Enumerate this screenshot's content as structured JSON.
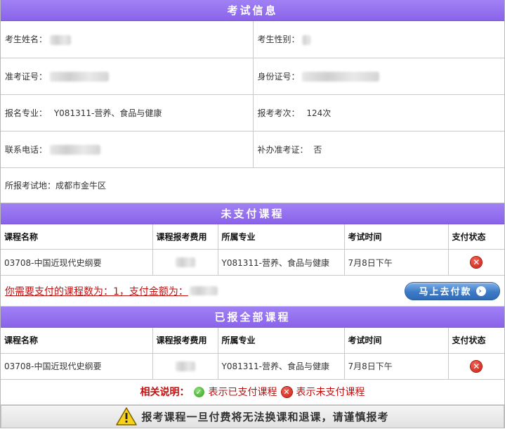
{
  "exam_info": {
    "title": "考试信息",
    "name_label": "考生姓名：",
    "gender_label": "考生性别：",
    "ticket_label": "准考证号：",
    "id_label": "身份证号：",
    "major_label": "报名专业：",
    "major_value": "Y081311-营养、食品与健康",
    "session_label": "报考考次：",
    "session_value": "124次",
    "phone_label": "联系电话：",
    "reissue_label": "补办准考证：",
    "reissue_value": "否",
    "location_label": "所报考试地：",
    "location_value": "成都市金牛区"
  },
  "unpaid": {
    "title": "未支付课程",
    "columns": [
      "课程名称",
      "课程报考费用",
      "所属专业",
      "考试时间",
      "支付状态"
    ],
    "rows": [
      {
        "course": "03708-中国近现代史纲要",
        "major": "Y081311-营养、食品与健康",
        "time": "7月8日下午",
        "status_icon": "x-icon"
      }
    ],
    "pay_summary": "你需要支付的课程数为：1，支付金额为：",
    "pay_button": "马上去付款"
  },
  "registered": {
    "title": "已报全部课程",
    "columns": [
      "课程名称",
      "课程报考费用",
      "所属专业",
      "考试时间",
      "支付状态"
    ],
    "rows": [
      {
        "course": "03708-中国近现代史纲要",
        "major": "Y081311-营养、食品与健康",
        "time": "7月8日下午",
        "status_icon": "x-icon"
      }
    ]
  },
  "legend": {
    "title": "相关说明：",
    "paid_text": "表示已支付课程",
    "unpaid_text": "表示未支付课程"
  },
  "warning": {
    "text": "报考课程一旦付费将无法换课和退课，请谨慎报考"
  },
  "colors": {
    "header_purple": "#8a63ea",
    "alert_red": "#c01010",
    "button_blue": "#3d7bc7"
  }
}
